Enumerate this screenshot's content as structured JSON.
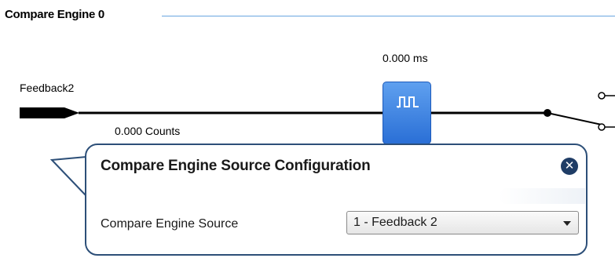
{
  "group": {
    "title": "Compare Engine 0"
  },
  "diagram": {
    "timing_label": "0.000 ms",
    "input_label": "Feedback2",
    "counts_label": "0.000 Counts",
    "pulse_block_icon": "pulse-train-icon",
    "switch_icon": "switch-icon"
  },
  "popup": {
    "title": "Compare Engine Source Configuration",
    "close_icon": "close-icon",
    "field_label": "Compare Engine Source",
    "selected_value": "1 - Feedback 2",
    "dropdown_icon": "chevron-down-icon"
  },
  "colors": {
    "accent_line": "#6aa6e0",
    "block_blue": "#2a6fd6",
    "popup_border": "#2d4f78",
    "close_button": "#1f3d66"
  }
}
